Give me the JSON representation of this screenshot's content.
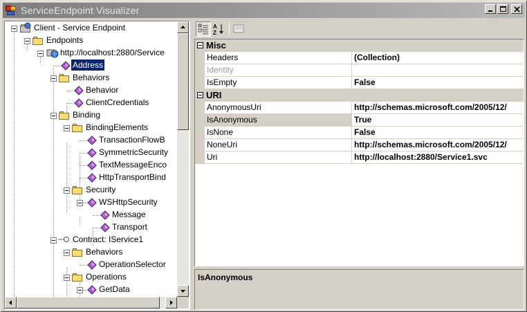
{
  "window": {
    "title": "ServiceEndpoint Visualizer"
  },
  "tree": {
    "root": "Client - Service Endpoint",
    "endpoints": "Endpoints",
    "endpoint": "http://localhost:2880/Service",
    "address": "Address",
    "behaviors": "Behaviors",
    "behavior": "Behavior",
    "client_credentials": "ClientCredentials",
    "binding": "Binding",
    "binding_elements": "BindingElements",
    "transaction_flow": "TransactionFlowB",
    "symmetric_security": "SymmetricSecurity",
    "text_message": "TextMessageEnco",
    "http_transport": "HttpTransportBind",
    "security": "Security",
    "ws_http_security": "WSHttpSecurity",
    "message": "Message",
    "transport": "Transport",
    "contract": "Contract: IService1",
    "contract_behaviors": "Behaviors",
    "operation_selector": "OperationSelector",
    "operations": "Operations",
    "get_data": "GetData"
  },
  "property_grid": {
    "toolbar": [
      "categorized-icon",
      "alphabetical-icon",
      "property-pages-icon"
    ],
    "categories": [
      {
        "name": "Misc",
        "properties": [
          {
            "name": "Headers",
            "value": "(Collection)"
          },
          {
            "name": "Identity",
            "value": ""
          },
          {
            "name": "IsEmpty",
            "value": "False"
          }
        ]
      },
      {
        "name": "URI",
        "properties": [
          {
            "name": "AnonymousUri",
            "value": "http://schemas.microsoft.com/2005/12/"
          },
          {
            "name": "IsAnonymous",
            "value": "True"
          },
          {
            "name": "IsNone",
            "value": "False"
          },
          {
            "name": "NoneUri",
            "value": "http://schemas.microsoft.com/2005/12/"
          },
          {
            "name": "Uri",
            "value": "http://localhost:2880/Service1.svc"
          }
        ]
      }
    ],
    "description_title": "IsAnonymous"
  }
}
